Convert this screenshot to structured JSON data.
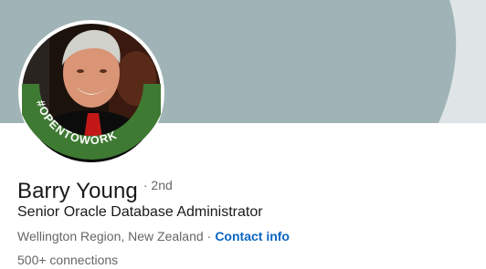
{
  "profile": {
    "name": "Barry Young",
    "degree": "· 2nd",
    "headline": "Senior Oracle Database Administrator",
    "location": "Wellington Region, New Zealand",
    "separator": "·",
    "contact_info_label": "Contact info",
    "connections": "500+ connections",
    "open_to_work_badge": "#OPENTOWORK"
  },
  "colors": {
    "banner": "#a0b4b7",
    "open_to_work_ring": "#3f7a33",
    "link": "#0a66c2",
    "text_primary": "#191919",
    "text_secondary": "#666666"
  },
  "icons": {
    "avatar": "profile-photo"
  }
}
